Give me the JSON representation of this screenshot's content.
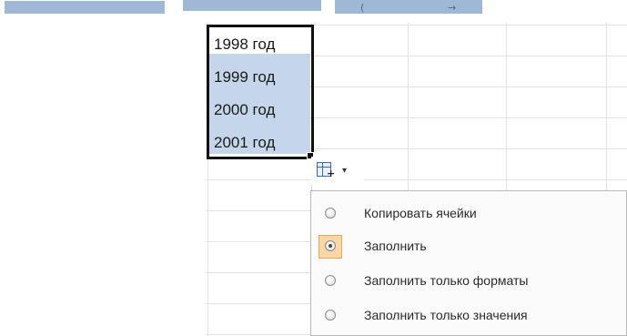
{
  "ribbon": {
    "left_arrow_glyph": "(",
    "right_arrow_glyph": "→"
  },
  "cells": [
    {
      "text": "1998 год",
      "selected_fill": false
    },
    {
      "text": "1999 год",
      "selected_fill": true
    },
    {
      "text": "2000 год",
      "selected_fill": true
    },
    {
      "text": "2001 год",
      "selected_fill": true
    }
  ],
  "autofill_button": {
    "icon": "autofill-options-icon",
    "caret": "▾"
  },
  "autofill_menu": {
    "items": [
      {
        "label": "Копировать ячейки",
        "checked": false,
        "highlighted": false
      },
      {
        "label": "Заполнить",
        "checked": true,
        "highlighted": true
      },
      {
        "label": "Заполнить только форматы",
        "checked": false,
        "highlighted": false
      },
      {
        "label": "Заполнить только значения",
        "checked": false,
        "highlighted": false
      }
    ]
  },
  "colors": {
    "selection_fill": "#c5d6ea",
    "selection_border": "#111111",
    "highlight": "#f9d7a6",
    "ribbon": "#9fb8d6"
  }
}
